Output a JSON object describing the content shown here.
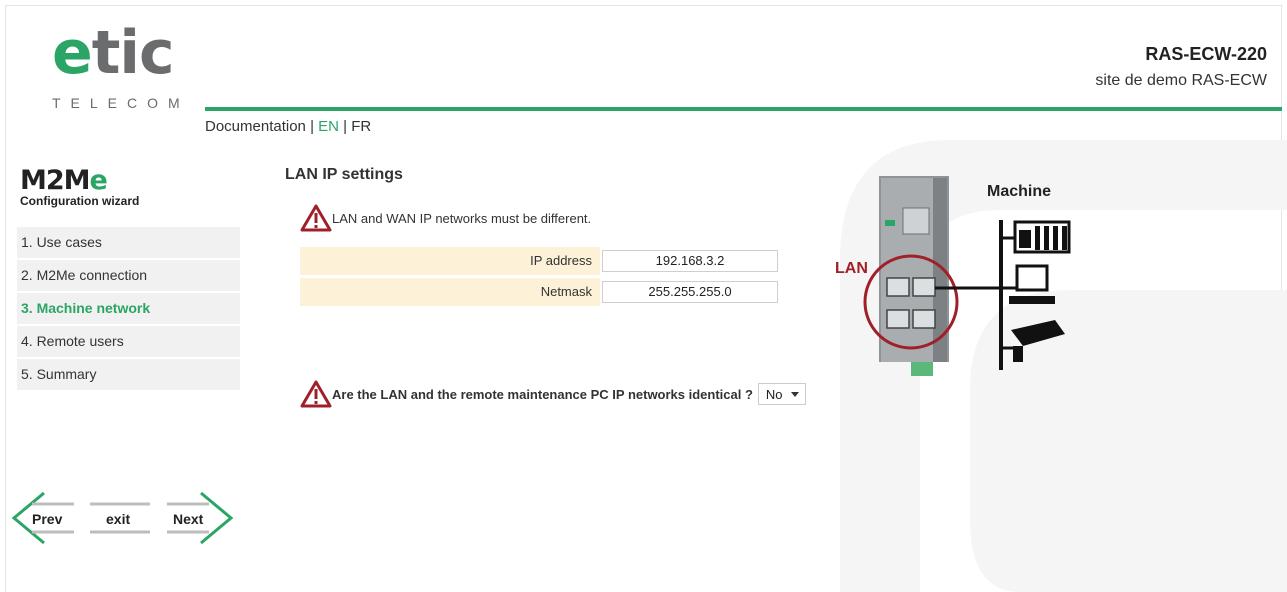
{
  "header": {
    "logo_word_e": "e",
    "logo_word_tic": "tic",
    "logo_sub": "TELECOM",
    "device_name": "RAS-ECW-220",
    "site_name": "site de demo RAS-ECW",
    "doc_link": "Documentation",
    "sep1": " | ",
    "lang_en": "EN",
    "sep2": " | ",
    "lang_fr": "FR"
  },
  "sidebar": {
    "wizard_title_m2m": "M2M",
    "wizard_title_e": "e",
    "wizard_subtitle": "Configuration wizard",
    "items": [
      {
        "label": "1. Use cases"
      },
      {
        "label": "2. M2Me connection"
      },
      {
        "label": "3. Machine network"
      },
      {
        "label": "4. Remote users"
      },
      {
        "label": "5. Summary"
      }
    ],
    "active_index": 2
  },
  "pager": {
    "prev_label": "Prev",
    "exit_label": "exit",
    "next_label": "Next"
  },
  "main": {
    "title": "LAN IP settings",
    "warning": "LAN and WAN IP networks must be different.",
    "fields": [
      {
        "label": "IP address",
        "value": "192.168.3.2"
      },
      {
        "label": "Netmask",
        "value": "255.255.255.0"
      }
    ],
    "question": "Are the LAN and the remote maintenance PC IP networks identical ?",
    "question_value": "No"
  },
  "diagram": {
    "lan_label": "LAN",
    "machine_label": "Machine"
  },
  "colors": {
    "brand_green": "#2ba565",
    "warning_red": "#a0202a",
    "field_label_bg": "#fdf1d8",
    "nav_bg": "#f1f1f1"
  }
}
